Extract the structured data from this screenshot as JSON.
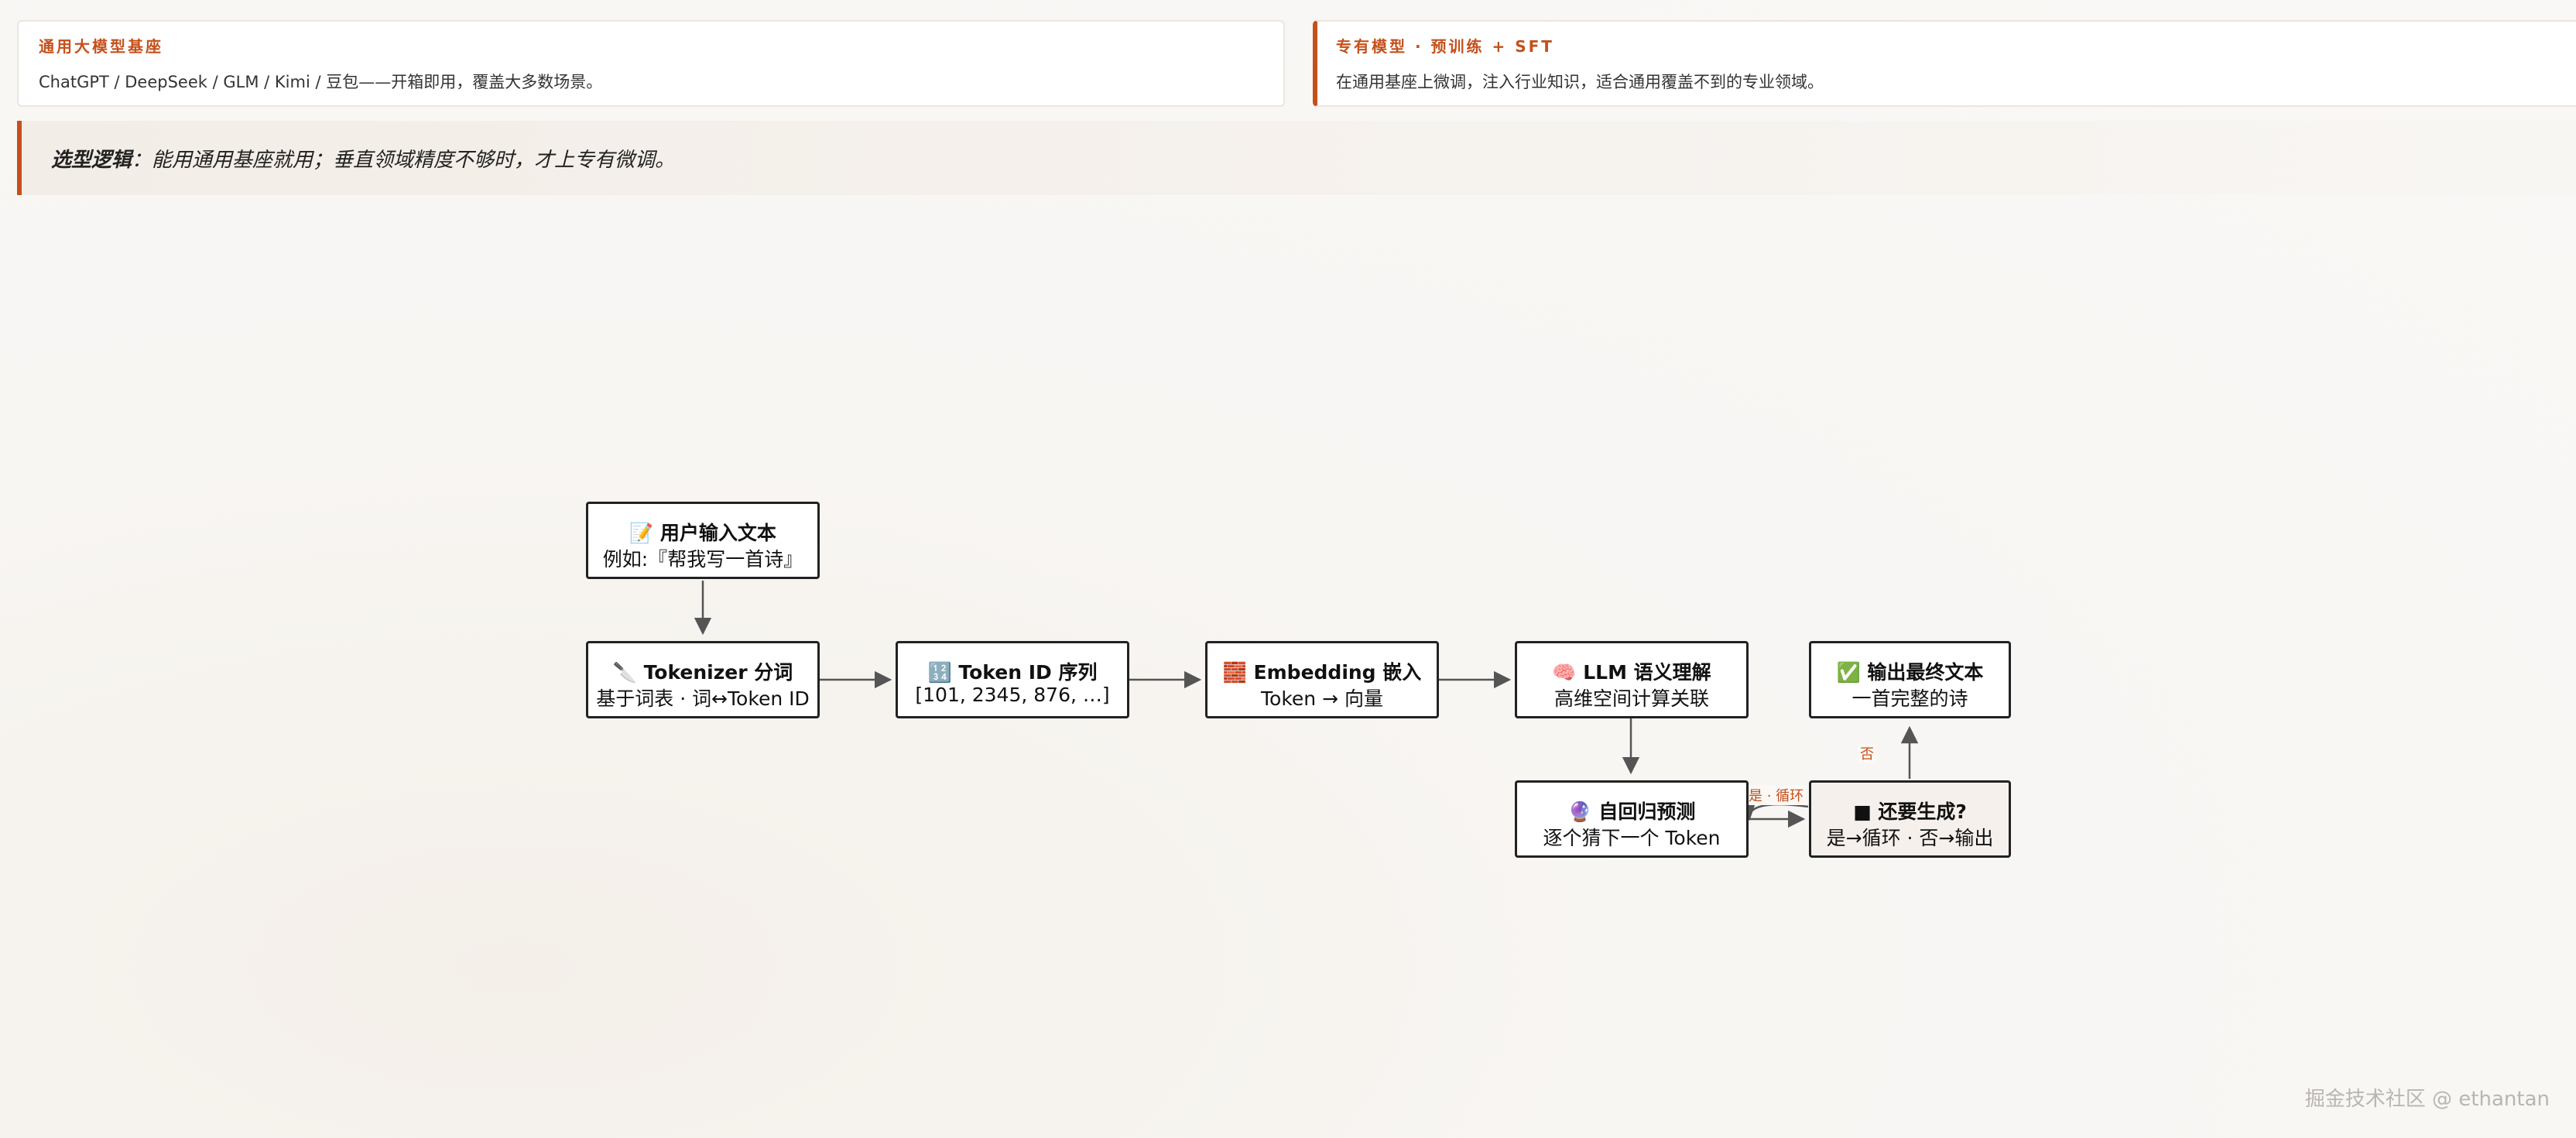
{
  "cards": {
    "general": {
      "title": "通用大模型基座",
      "text": "ChatGPT / DeepSeek / GLM / Kimi / 豆包——开箱即用，覆盖大多数场景。"
    },
    "special": {
      "title": "专有模型 · 预训练 + SFT",
      "text": "在通用基座上微调，注入行业知识，适合通用覆盖不到的专业领域。"
    }
  },
  "note": {
    "label": "选型逻辑",
    "text": "：能用通用基座就用；垂直领域精度不够时，才上专有微调。"
  },
  "flow": {
    "input": {
      "icon": "📝",
      "title": "用户输入文本",
      "sub": "例如:『帮我写一首诗』"
    },
    "tokenizer": {
      "icon": "🔪",
      "title": "Tokenizer 分词",
      "sub": "基于词表 · 词↔Token ID"
    },
    "token_ids": {
      "icon": "🔢",
      "title": "Token ID 序列",
      "sub": "[101, 2345, 876, …]"
    },
    "embedding": {
      "icon": "🧱",
      "title": "Embedding 嵌入",
      "sub": "Token → 向量"
    },
    "llm": {
      "icon": "🧠",
      "title": "LLM 语义理解",
      "sub": "高维空间计算关联"
    },
    "predict": {
      "icon": "🔮",
      "title": "自回归预测",
      "sub": "逐个猜下一个 Token"
    },
    "decide": {
      "icon": "■",
      "title": "还要生成?",
      "sub": "是→循环 · 否→输出"
    },
    "output": {
      "icon": "✅",
      "title": "输出最终文本",
      "sub": "一首完整的诗"
    }
  },
  "edges": {
    "yes_loop": "是 · 循环",
    "no": "否"
  },
  "watermark": "掘金技术社区 @ ethantan",
  "colors": {
    "accent": "#c4501c",
    "node_border": "#222222",
    "arrow": "#555555"
  }
}
